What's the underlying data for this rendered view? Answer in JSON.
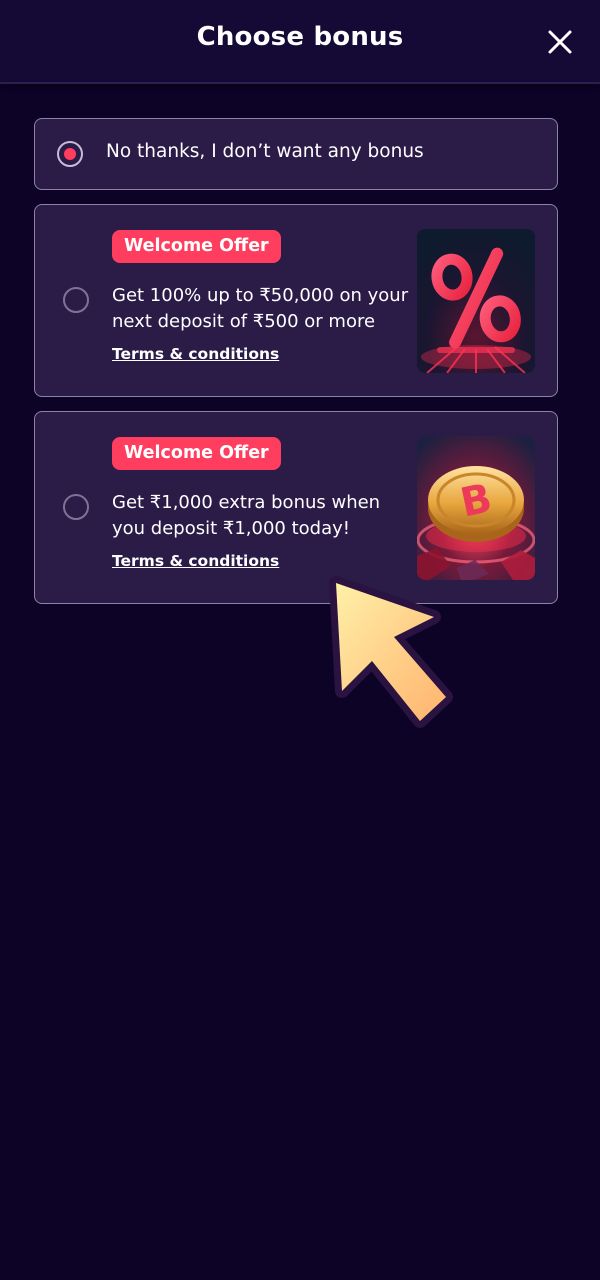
{
  "header": {
    "title": "Choose bonus",
    "close_icon": "close-icon"
  },
  "options": {
    "no_bonus": {
      "label": "No thanks, I don’t want any bonus",
      "selected": true
    },
    "offers": [
      {
        "badge": "Welcome Offer",
        "description": "Get 100% up to ₹50,000 on your next deposit of ₹500 or more",
        "terms": "Terms & conditions",
        "image_icon": "percent-icon",
        "selected": false
      },
      {
        "badge": "Welcome Offer",
        "description": "Get ₹1,000 extra bonus when you deposit ₹1,000 today!",
        "terms": "Terms & conditions",
        "image_icon": "bitcoin-coin-icon",
        "selected": false
      }
    ]
  },
  "colors": {
    "background": "#0c0327",
    "card": "#2a1b47",
    "accent": "#ff3d5e",
    "cursor": "#ffc579"
  }
}
